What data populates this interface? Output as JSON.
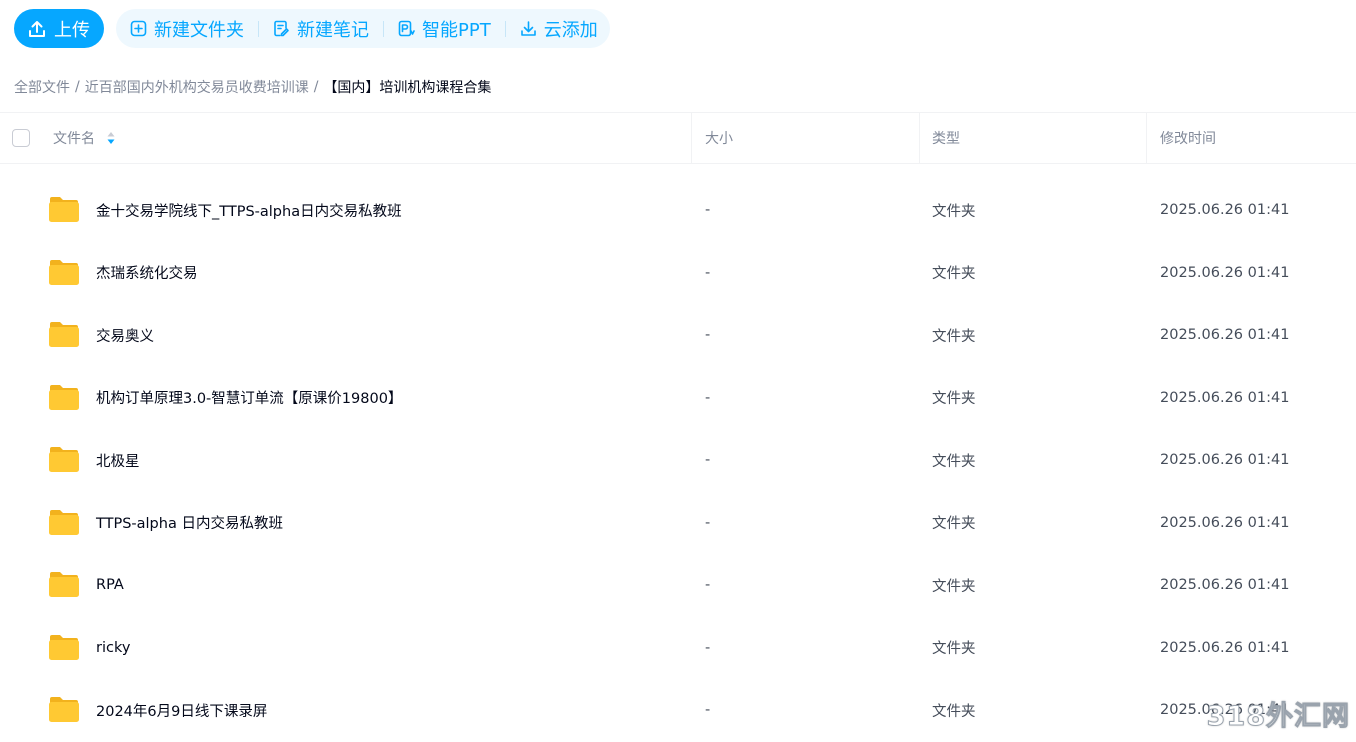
{
  "toolbar": {
    "upload_label": "上传",
    "new_folder_label": "新建文件夹",
    "new_note_label": "新建笔记",
    "smart_ppt_label": "智能PPT",
    "cloud_add_label": "云添加"
  },
  "breadcrumb": {
    "root": "全部文件",
    "level1": "近百部国内外机构交易员收费培训课",
    "current": "【国内】培训机构课程合集",
    "separator": "/"
  },
  "table": {
    "headers": {
      "name": "文件名",
      "size": "大小",
      "type": "类型",
      "modified": "修改时间"
    },
    "rows": [
      {
        "name": "金十交易学院线下_TTPS-alpha日内交易私教班",
        "size": "-",
        "type": "文件夹",
        "modified": "2025.06.26 01:41"
      },
      {
        "name": "杰瑞系统化交易",
        "size": "-",
        "type": "文件夹",
        "modified": "2025.06.26 01:41"
      },
      {
        "name": "交易奥义",
        "size": "-",
        "type": "文件夹",
        "modified": "2025.06.26 01:41"
      },
      {
        "name": "机构订单原理3.0-智慧订单流【原课价19800】",
        "size": "-",
        "type": "文件夹",
        "modified": "2025.06.26 01:41"
      },
      {
        "name": "北极星",
        "size": "-",
        "type": "文件夹",
        "modified": "2025.06.26 01:41"
      },
      {
        "name": "TTPS-alpha 日内交易私教班",
        "size": "-",
        "type": "文件夹",
        "modified": "2025.06.26 01:41"
      },
      {
        "name": "RPA",
        "size": "-",
        "type": "文件夹",
        "modified": "2025.06.26 01:41"
      },
      {
        "name": "ricky",
        "size": "-",
        "type": "文件夹",
        "modified": "2025.06.26 01:41"
      },
      {
        "name": "2024年6月9日线下课录屏",
        "size": "-",
        "type": "文件夹",
        "modified": "2025.06.26 01:41"
      }
    ]
  },
  "watermark": "318外汇网",
  "colors": {
    "accent": "#06a7ff",
    "tool_bg": "#eef8fe",
    "folder_yellow": "#ffc933"
  },
  "icons": {
    "upload": "upload-icon",
    "new_folder": "plus-square-icon",
    "new_note": "note-edit-icon",
    "smart_ppt": "ppt-icon",
    "cloud_add": "download-icon",
    "sort": "sort-icon",
    "folder": "folder-icon"
  }
}
